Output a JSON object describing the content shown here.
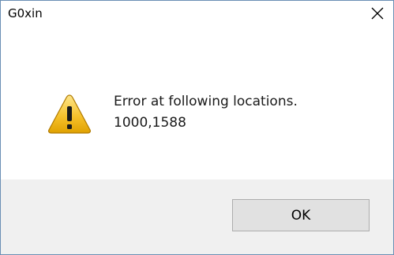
{
  "window": {
    "title": "G0xin",
    "close_icon": "close-icon"
  },
  "message": {
    "icon": "warning-icon",
    "line1": "Error at following locations.",
    "line2": "1000,1588"
  },
  "buttons": {
    "ok_label": "OK"
  },
  "colors": {
    "footer_bg": "#f0f0f0",
    "button_bg": "#e1e1e1",
    "button_border": "#adadad",
    "warning_fill": "#f6c22d",
    "window_border": "#6a8fb4"
  }
}
